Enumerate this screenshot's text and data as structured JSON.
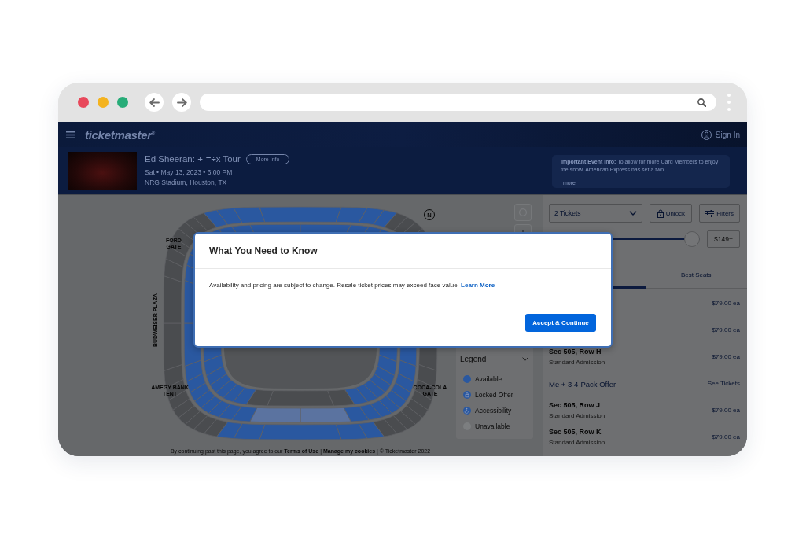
{
  "header": {
    "logo": "ticketmaster$^{®}$",
    "sign_in": "Sign In"
  },
  "event": {
    "title": "Ed Sheeran: +-=÷x Tour",
    "more_info": "More Info",
    "date": "Sat • May 13, 2023 • 6:00 PM",
    "venue": "NRG Stadium, Houston, TX",
    "notice": {
      "text": "**Important Event Info:** To allow for more Card Members to enjoy the show, American Express has set a two...",
      "link": "more"
    }
  },
  "map": {
    "compass": "N",
    "gates": [
      {
        "label": "FORD GATE",
        "kind": "horizontal"
      },
      {
        "label": "BUDWEISER PLAZA",
        "kind": "vertical"
      },
      {
        "label": "AMEGY BANK TENT",
        "kind": "horizontal"
      },
      {
        "label": "COCA-COLA GATE",
        "kind": "horizontal"
      }
    ],
    "legend": {
      "title": "Legend",
      "items": [
        {
          "label": "Available",
          "kind": "dot",
          "color": "#2a58a0"
        },
        {
          "label": "Locked Offer",
          "kind": "lock",
          "color": "#2a58a0"
        },
        {
          "label": "Accessibility",
          "kind": "accessible",
          "color": "#2a58a0"
        },
        {
          "label": "Unavailable",
          "kind": "dot",
          "color": "#7c7e80"
        }
      ]
    },
    "footer": [
      {
        "kind": "text",
        "text": "By continuing past this page, you agree to our"
      },
      {
        "kind": "link",
        "text": "Terms of Use"
      },
      {
        "kind": "text",
        "text": "|"
      },
      {
        "kind": "link",
        "text": "Manage my cookies"
      },
      {
        "kind": "text",
        "text": "| © Ticketmaster 2022"
      }
    ]
  },
  "filters": {
    "quantity": "2 Tickets",
    "unlock": "Unlock",
    "filters": "Filters",
    "price_slider": {
      "level": 1
    },
    "max_price": "$149+"
  },
  "tabs": [
    {
      "selected": true
    },
    {
      "label": "Best Seats",
      "selected": false
    }
  ],
  "listings": [
    {
      "kind": "listing",
      "price": "$79.00 ea"
    },
    {
      "kind": "listing",
      "price": "$79.00 ea"
    },
    {
      "kind": "listing",
      "section": "Sec 505, Row H",
      "type": "Standard Admission",
      "price": "$79.00 ea"
    },
    {
      "kind": "offer",
      "title": "Me + 3 4-Pack Offer",
      "action": "See Tickets"
    },
    {
      "kind": "listing",
      "section": "Sec 505, Row J",
      "type": "Standard Admission",
      "price": "$79.00 ea"
    },
    {
      "kind": "listing",
      "section": "Sec 505, Row K",
      "type": "Standard Admission",
      "price": "$79.00 ea"
    }
  ],
  "modal": {
    "title": "What You Need to Know",
    "message": "Availability and pricing are subject to change. Resale ticket prices may exceed face value.",
    "link": "Learn More",
    "button": "Accept & Continue"
  }
}
